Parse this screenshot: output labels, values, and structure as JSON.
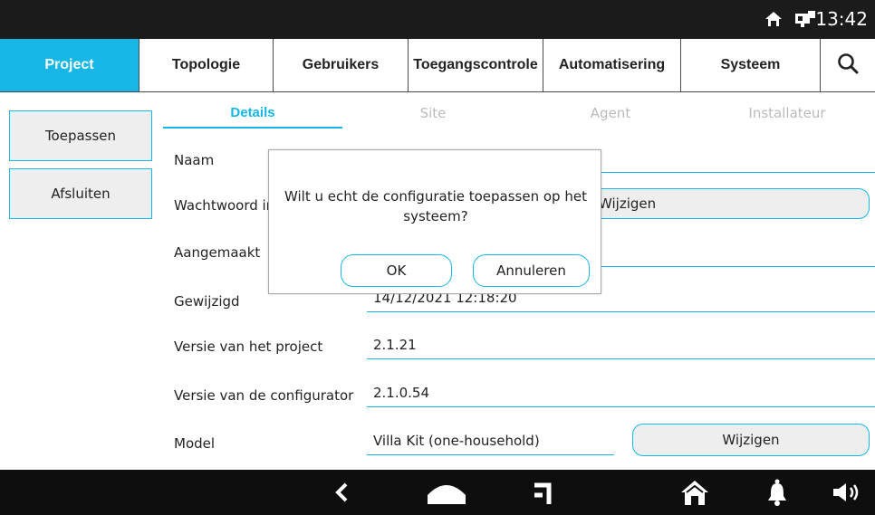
{
  "status": {
    "time": "13:42",
    "home_icon": "home-icon",
    "network_icon": "network-icon"
  },
  "nav": {
    "tabs": [
      {
        "label": "Project",
        "active": true
      },
      {
        "label": "Topologie"
      },
      {
        "label": "Gebruikers"
      },
      {
        "label": "Toegangscontrole"
      },
      {
        "label": "Automatisering"
      },
      {
        "label": "Systeem"
      }
    ],
    "search_icon": "search-icon"
  },
  "sidebar": {
    "apply": "Toepassen",
    "close": "Afsluiten"
  },
  "subtabs": [
    "Details",
    "Site",
    "Agent",
    "Installateur"
  ],
  "form": {
    "name_label": "Naam",
    "password_label": "Wachtwoord ir",
    "password_button": "Wijzigen",
    "created_label": "Aangemaakt",
    "modified_label": "Gewijzigd",
    "modified_value": "14/12/2021 12:18:20",
    "project_version_label": "Versie van het project",
    "project_version_value": "2.1.21",
    "configurator_version_label": "Versie van de configurator",
    "configurator_version_value": "2.1.0.54",
    "model_label": "Model",
    "model_value": "Villa Kit (one-household)",
    "model_button": "Wijzigen"
  },
  "dialog": {
    "message": "Wilt u echt de configuratie toepassen op het systeem?",
    "ok": "OK",
    "cancel": "Annuleren"
  },
  "bottom": {
    "icons": [
      "back-icon",
      "home-shape-icon",
      "recent-icon",
      "house-icon",
      "bell-icon",
      "volume-icon"
    ]
  },
  "colors": {
    "accent": "#16b6e6",
    "bar": "#1b1b1b",
    "button_bg": "#eeeeee"
  }
}
